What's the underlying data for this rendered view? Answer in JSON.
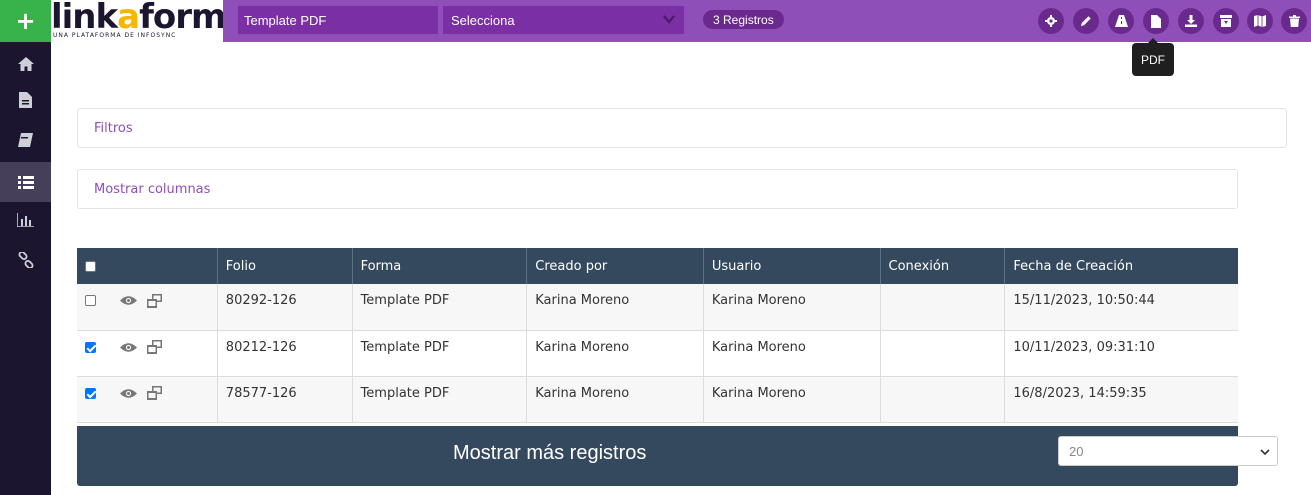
{
  "sidebar": {
    "add_label": "+",
    "items": [
      {
        "icon": "home-icon"
      },
      {
        "icon": "document-icon"
      },
      {
        "icon": "book-icon"
      },
      {
        "icon": "list-icon",
        "active": true
      },
      {
        "icon": "bar-chart-icon"
      },
      {
        "icon": "link-icon"
      }
    ]
  },
  "logo": {
    "word_start": "link",
    "word_accent": "a",
    "word_end": "form",
    "tagline": "UNA PLATAFORMA DE INFOSYNC"
  },
  "topbar": {
    "form_name": "Template PDF",
    "select_value": "Selecciona",
    "records_badge": "3 Registros",
    "icons": [
      "gear-icon",
      "pencil-icon",
      "road-icon",
      "pdf-file-icon",
      "download-icon",
      "archive-icon",
      "map-icon",
      "trash-icon"
    ],
    "tooltip": "PDF"
  },
  "panels": {
    "filters": "Filtros",
    "columns": "Mostrar columnas"
  },
  "table": {
    "headers": [
      "",
      "Folio",
      "Forma",
      "Creado por",
      "Usuario",
      "Conexión",
      "Fecha de Creación"
    ],
    "rows": [
      {
        "checked": false,
        "folio": "80292-126",
        "forma": "Template PDF",
        "creado_por": "Karina Moreno",
        "usuario": "Karina Moreno",
        "conexion": "",
        "fecha": "15/11/2023, 10:50:44"
      },
      {
        "checked": true,
        "folio": "80212-126",
        "forma": "Template PDF",
        "creado_por": "Karina Moreno",
        "usuario": "Karina Moreno",
        "conexion": "",
        "fecha": "10/11/2023, 09:31:10"
      },
      {
        "checked": true,
        "folio": "78577-126",
        "forma": "Template PDF",
        "creado_por": "Karina Moreno",
        "usuario": "Karina Moreno",
        "conexion": "",
        "fecha": "16/8/2023, 14:59:35"
      }
    ]
  },
  "footer": {
    "more_label": "Mostrar más registros",
    "page_size": "20"
  },
  "colors": {
    "brand_purple": "#8f4fb8",
    "sidebar_bg": "#1b1530",
    "add_green": "#37b34a",
    "table_header": "#34495e",
    "logo_accent": "#f5b700"
  }
}
